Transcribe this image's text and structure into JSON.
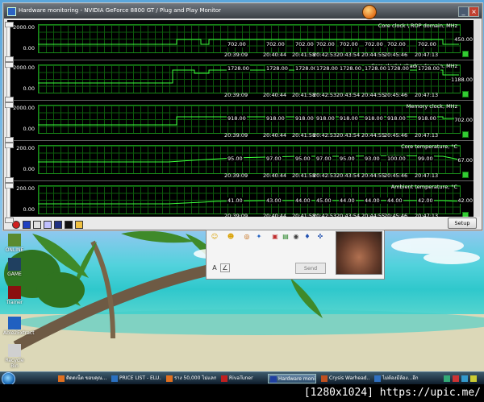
{
  "window": {
    "title": "Hardware monitoring - NVIDIA GeForce 8800 GT / Plug and Play Monitor",
    "buttons": {
      "minimize": "_",
      "close": "×"
    },
    "setup_label": "Setup"
  },
  "graphs": [
    {
      "title": "Core clock \\ ROP domain, MHz",
      "ymax": "2000.00",
      "ymin": "0.00",
      "current": "450.00",
      "times": [
        "20:39:09",
        "20:40:44",
        "20:41:58",
        "20:42:53",
        "20:43:54",
        "20:44:55",
        "20:45:46",
        "20:47:13"
      ],
      "labels": [
        "702.00",
        "702.00",
        "702.00",
        "702.00",
        "702.00",
        "702.00",
        "702.00",
        "702.00"
      ]
    },
    {
      "title": "Core clock \\ shader domain, MHz",
      "ymax": "2000.00",
      "ymin": "0.00",
      "current": "1188.00",
      "times": [
        "20:39:09",
        "20:40:44",
        "20:41:58",
        "20:42:53",
        "20:43:54",
        "20:44:55",
        "20:45:46",
        "20:47:13"
      ],
      "labels": [
        "1728.00",
        "1728.00",
        "1728.00",
        "1728.00",
        "1728.00",
        "1728.00",
        "1728.00",
        "1728.00"
      ]
    },
    {
      "title": "Memory clock, MHz",
      "ymax": "2000.00",
      "ymin": "0.00",
      "current": "702.00",
      "times": [
        "20:39:09",
        "20:40:44",
        "20:41:58",
        "20:42:53",
        "20:43:54",
        "20:44:55",
        "20:45:46",
        "20:47:13"
      ],
      "labels": [
        "918.00",
        "918.00",
        "918.00",
        "918.00",
        "918.00",
        "918.00",
        "918.00",
        "918.00"
      ]
    },
    {
      "title": "Core temperature, °C",
      "ymax": "200.00",
      "ymin": "0.00",
      "current": "67.00",
      "times": [
        "20:39:09",
        "20:40:44",
        "20:41:58",
        "20:42:53",
        "20:43:54",
        "20:44:55",
        "20:45:46",
        "20:47:13"
      ],
      "labels": [
        "95.00",
        "97.00",
        "95.00",
        "97.00",
        "95.00",
        "93.00",
        "100.00",
        "99.00"
      ]
    },
    {
      "title": "Ambient temperature, °C",
      "ymax": "200.00",
      "ymin": "0.00",
      "current": "42.00",
      "times": [
        "20:39:09",
        "20:40:44",
        "20:41:58",
        "20:42:53",
        "20:43:54",
        "20:44:55",
        "20:45:46",
        "20:47:13"
      ],
      "labels": [
        "41.00",
        "43.00",
        "44.00",
        "45.00",
        "44.00",
        "44.00",
        "44.00",
        "42.00"
      ]
    }
  ],
  "toolbar": {
    "icons": [
      "record-icon",
      "open-icon",
      "copy-icon",
      "paste-icon",
      "monitor-icon",
      "save-icon",
      "folder-icon"
    ]
  },
  "chat": {
    "send_label": "Send"
  },
  "desktop_icons": [
    {
      "label": "ONLINE",
      "icon": "online-icon"
    },
    {
      "label": "GAME",
      "icon": "game-icon"
    },
    {
      "label": "Trainer",
      "icon": "trainer-icon"
    },
    {
      "label": "Able2Extract",
      "icon": "able2extract-icon"
    },
    {
      "label": "Recycle Bin",
      "icon": "recycle-bin-icon"
    }
  ],
  "taskbar": {
    "items": [
      {
        "label": "ติดตเน็ต ขอบคุณ...",
        "active": false
      },
      {
        "label": "PRICE LIST - ELU...",
        "active": false
      },
      {
        "label": "ราง 50,000 ไม่แลก...",
        "active": false
      },
      {
        "label": "RivaTuner",
        "active": false
      },
      {
        "label": "Hardware monit...",
        "active": true
      },
      {
        "label": "Crysis Warhead...",
        "active": false
      },
      {
        "label": "ไม่ต้องมีล้อง...อีก",
        "active": false
      }
    ]
  },
  "watermark": "[1280x1024] https://upic.me/"
}
